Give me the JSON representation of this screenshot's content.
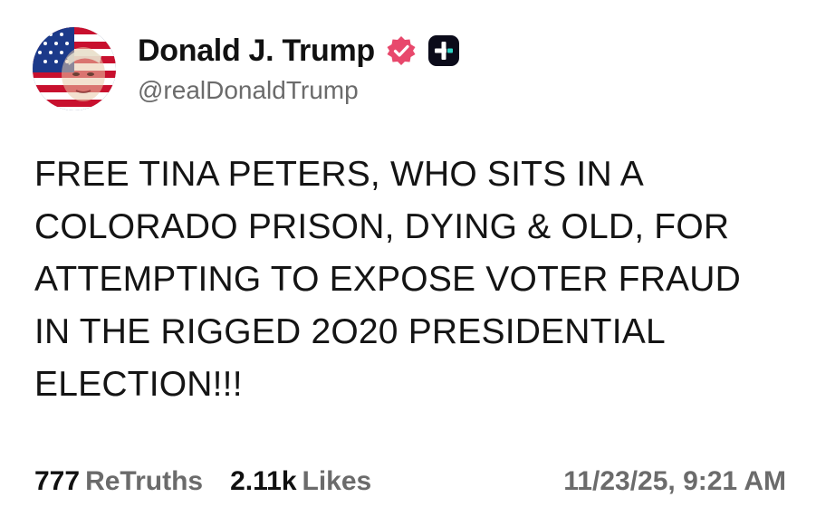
{
  "author": {
    "display_name": "Donald J. Trump",
    "handle": "@realDonaldTrump",
    "avatar_icon": "flag-portrait-avatar",
    "verified_icon": "verified-badge-icon",
    "platform_icon": "truth-social-logo-icon"
  },
  "post": {
    "lines": [
      "FREE TINA PETERS, WHO SITS IN A",
      "COLORADO PRISON, DYING & OLD, FOR",
      "ATTEMPTING TO EXPOSE VOTER FRAUD",
      "IN THE RIGGED 2O20 PRESIDENTIAL",
      "ELECTION!!!"
    ]
  },
  "stats": {
    "retruths_count": "777",
    "retruths_label": "ReTruths",
    "likes_count": "2.11k",
    "likes_label": "Likes",
    "timestamp": "11/23/25, 9:21 AM"
  },
  "colors": {
    "badge_pink": "#e8486c",
    "text_primary": "#111111",
    "text_secondary": "#6b6b6b",
    "logo_dark": "#0b0b1a",
    "logo_accent": "#2fd3c5"
  }
}
